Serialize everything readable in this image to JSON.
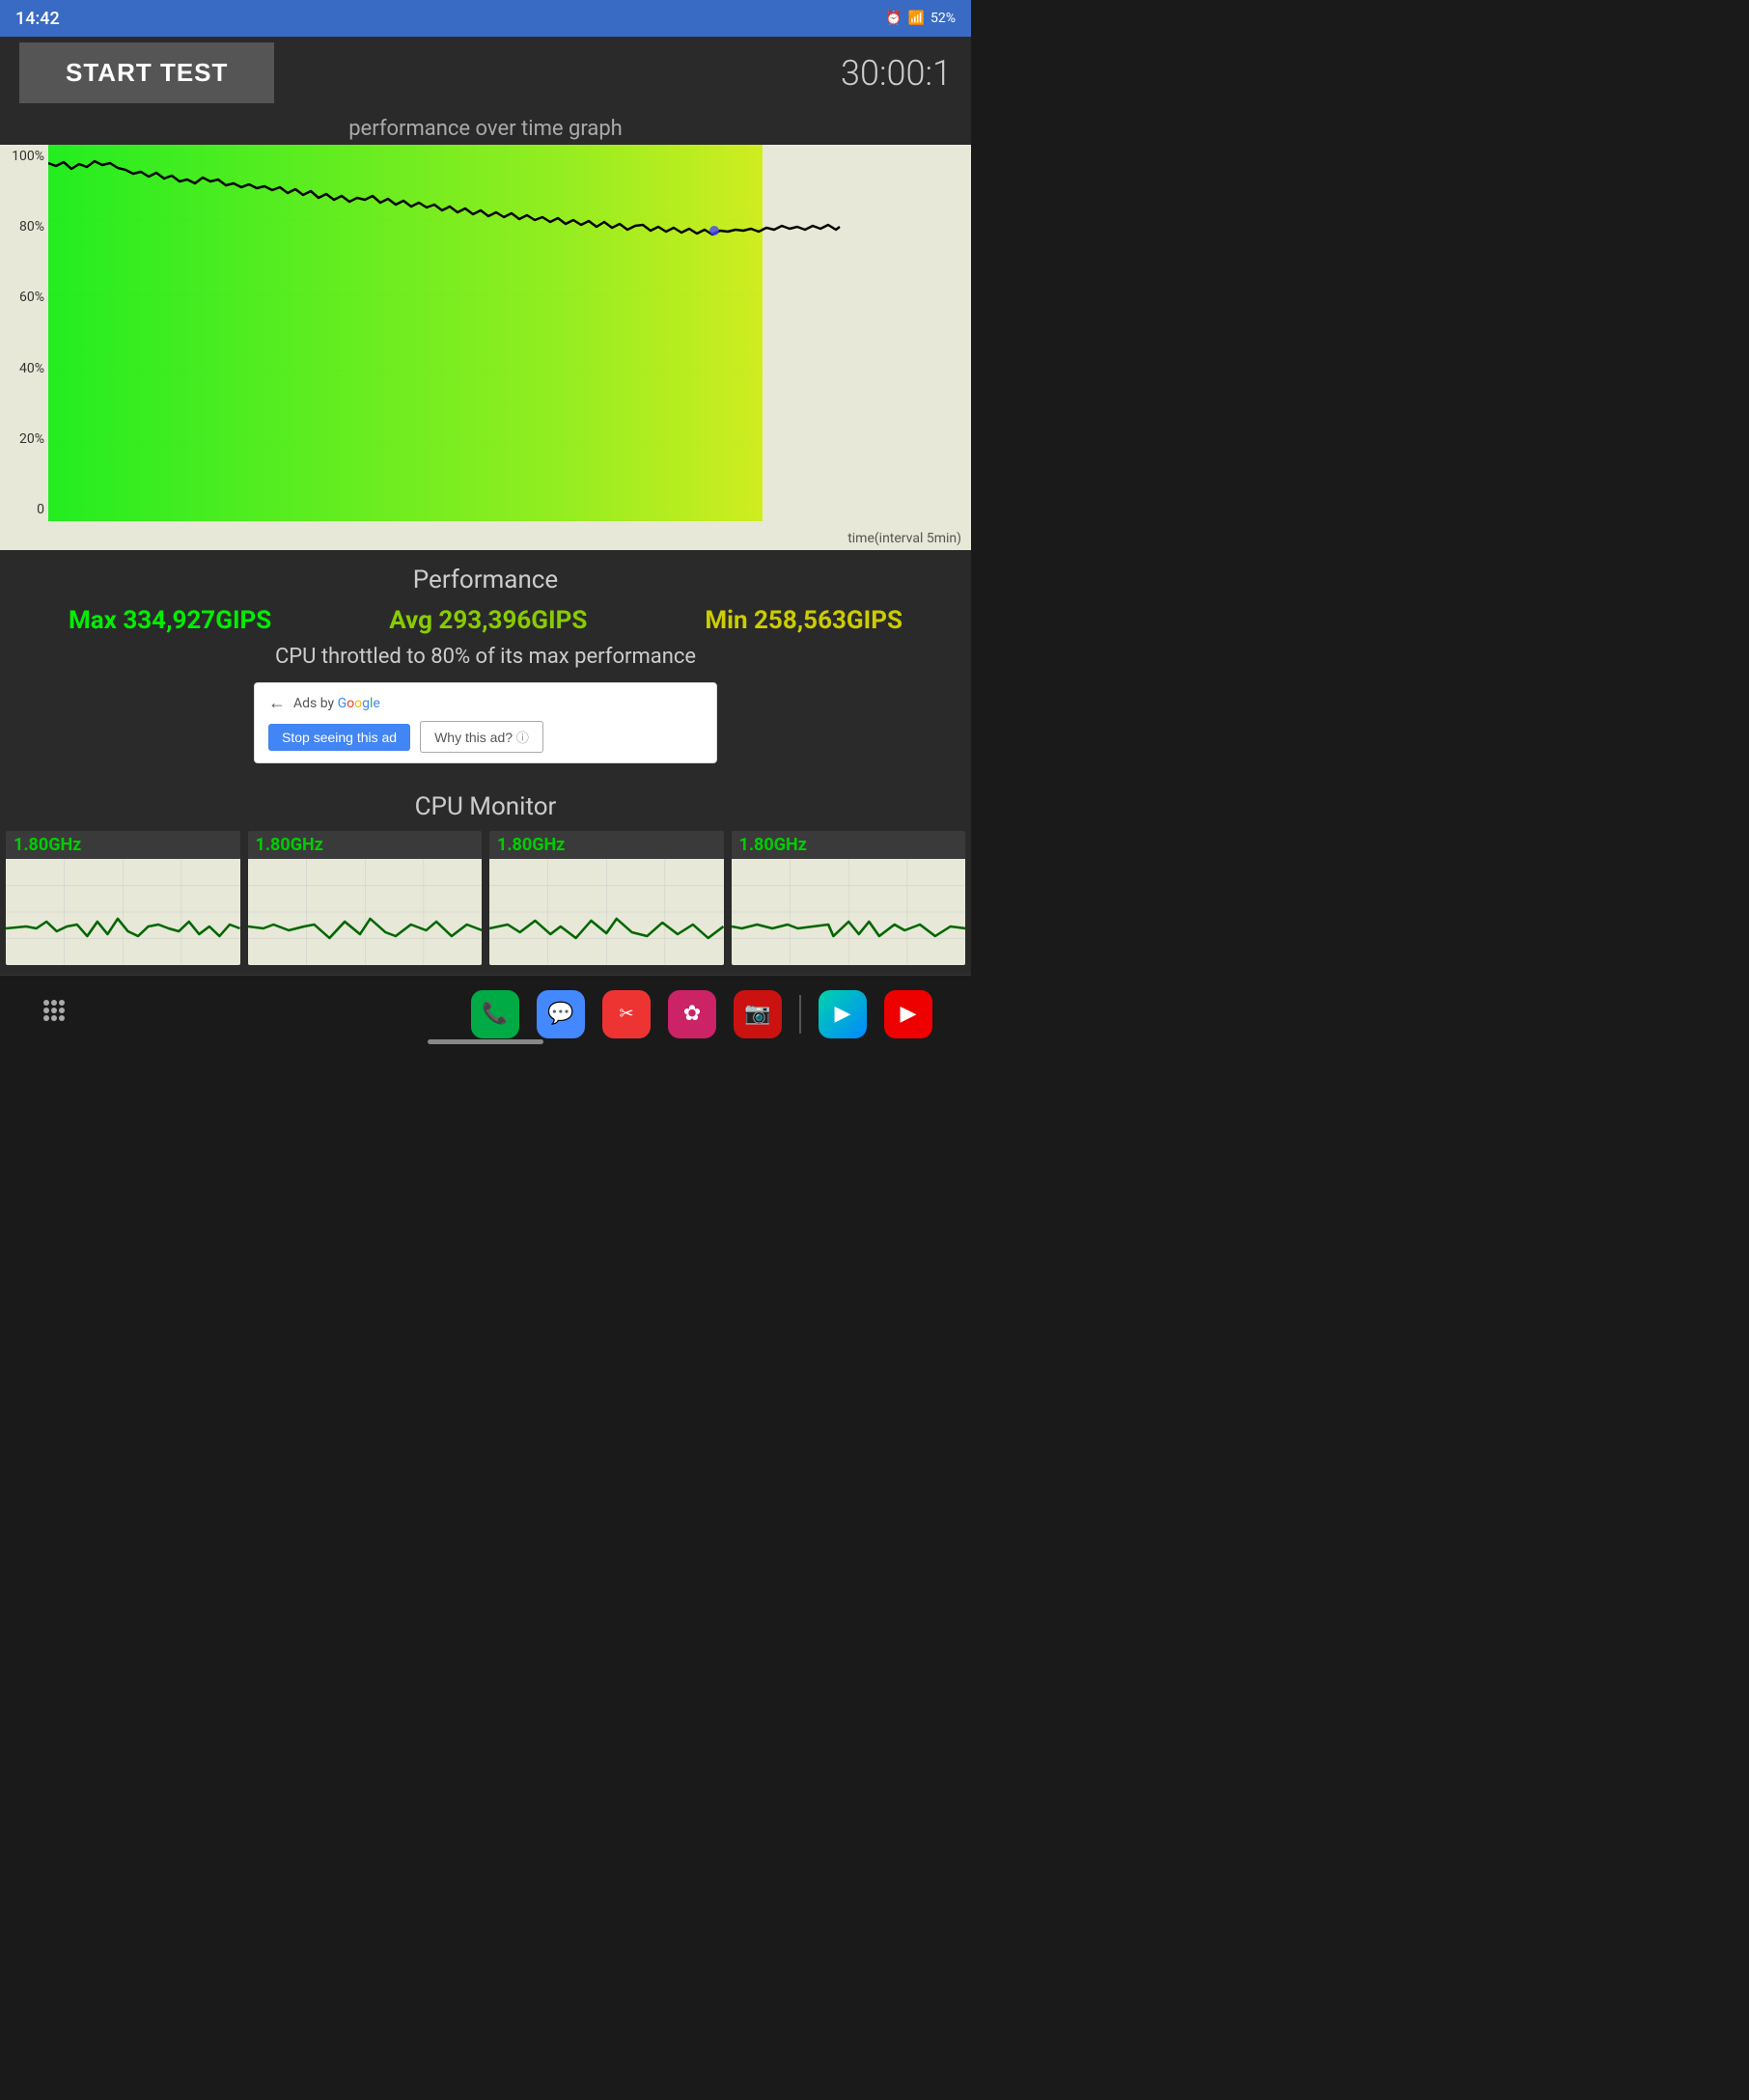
{
  "statusBar": {
    "time": "14:42",
    "battery": "52%",
    "signal": "LTE2"
  },
  "topBar": {
    "startTestLabel": "START TEST",
    "timer": "30:00:1"
  },
  "graph": {
    "title": "performance over time graph",
    "yLabels": [
      "100%",
      "80%",
      "60%",
      "40%",
      "20%",
      "0"
    ],
    "xLabel": "time(interval 5min)"
  },
  "performance": {
    "title": "Performance",
    "max": "Max 334,927GIPS",
    "avg": "Avg 293,396GIPS",
    "min": "Min 258,563GIPS",
    "throttleText": "CPU throttled to 80% of its max performance"
  },
  "ad": {
    "adsByGoogle": "Ads by Google",
    "stopLabel": "Stop seeing this ad",
    "whyLabel": "Why this ad?",
    "infoIcon": "ⓘ"
  },
  "cpuMonitor": {
    "title": "CPU Monitor",
    "cores": [
      {
        "freq": "1.80GHz"
      },
      {
        "freq": "1.80GHz"
      },
      {
        "freq": "1.80GHz"
      },
      {
        "freq": "1.80GHz"
      }
    ]
  },
  "navBar": {
    "appsGrid": "⁞⁞⁞",
    "apps": [
      {
        "name": "contacts",
        "color": "icon-green",
        "symbol": "📞"
      },
      {
        "name": "messages",
        "color": "icon-blue",
        "symbol": "💬"
      },
      {
        "name": "social",
        "color": "icon-red",
        "symbol": "✂"
      },
      {
        "name": "flower",
        "color": "icon-pink",
        "symbol": "✿"
      },
      {
        "name": "camera",
        "color": "icon-darkred",
        "symbol": "📷"
      },
      {
        "name": "play",
        "color": "icon-gradient-play",
        "symbol": "▶"
      },
      {
        "name": "youtube",
        "color": "icon-youtube",
        "symbol": "▶"
      }
    ]
  }
}
